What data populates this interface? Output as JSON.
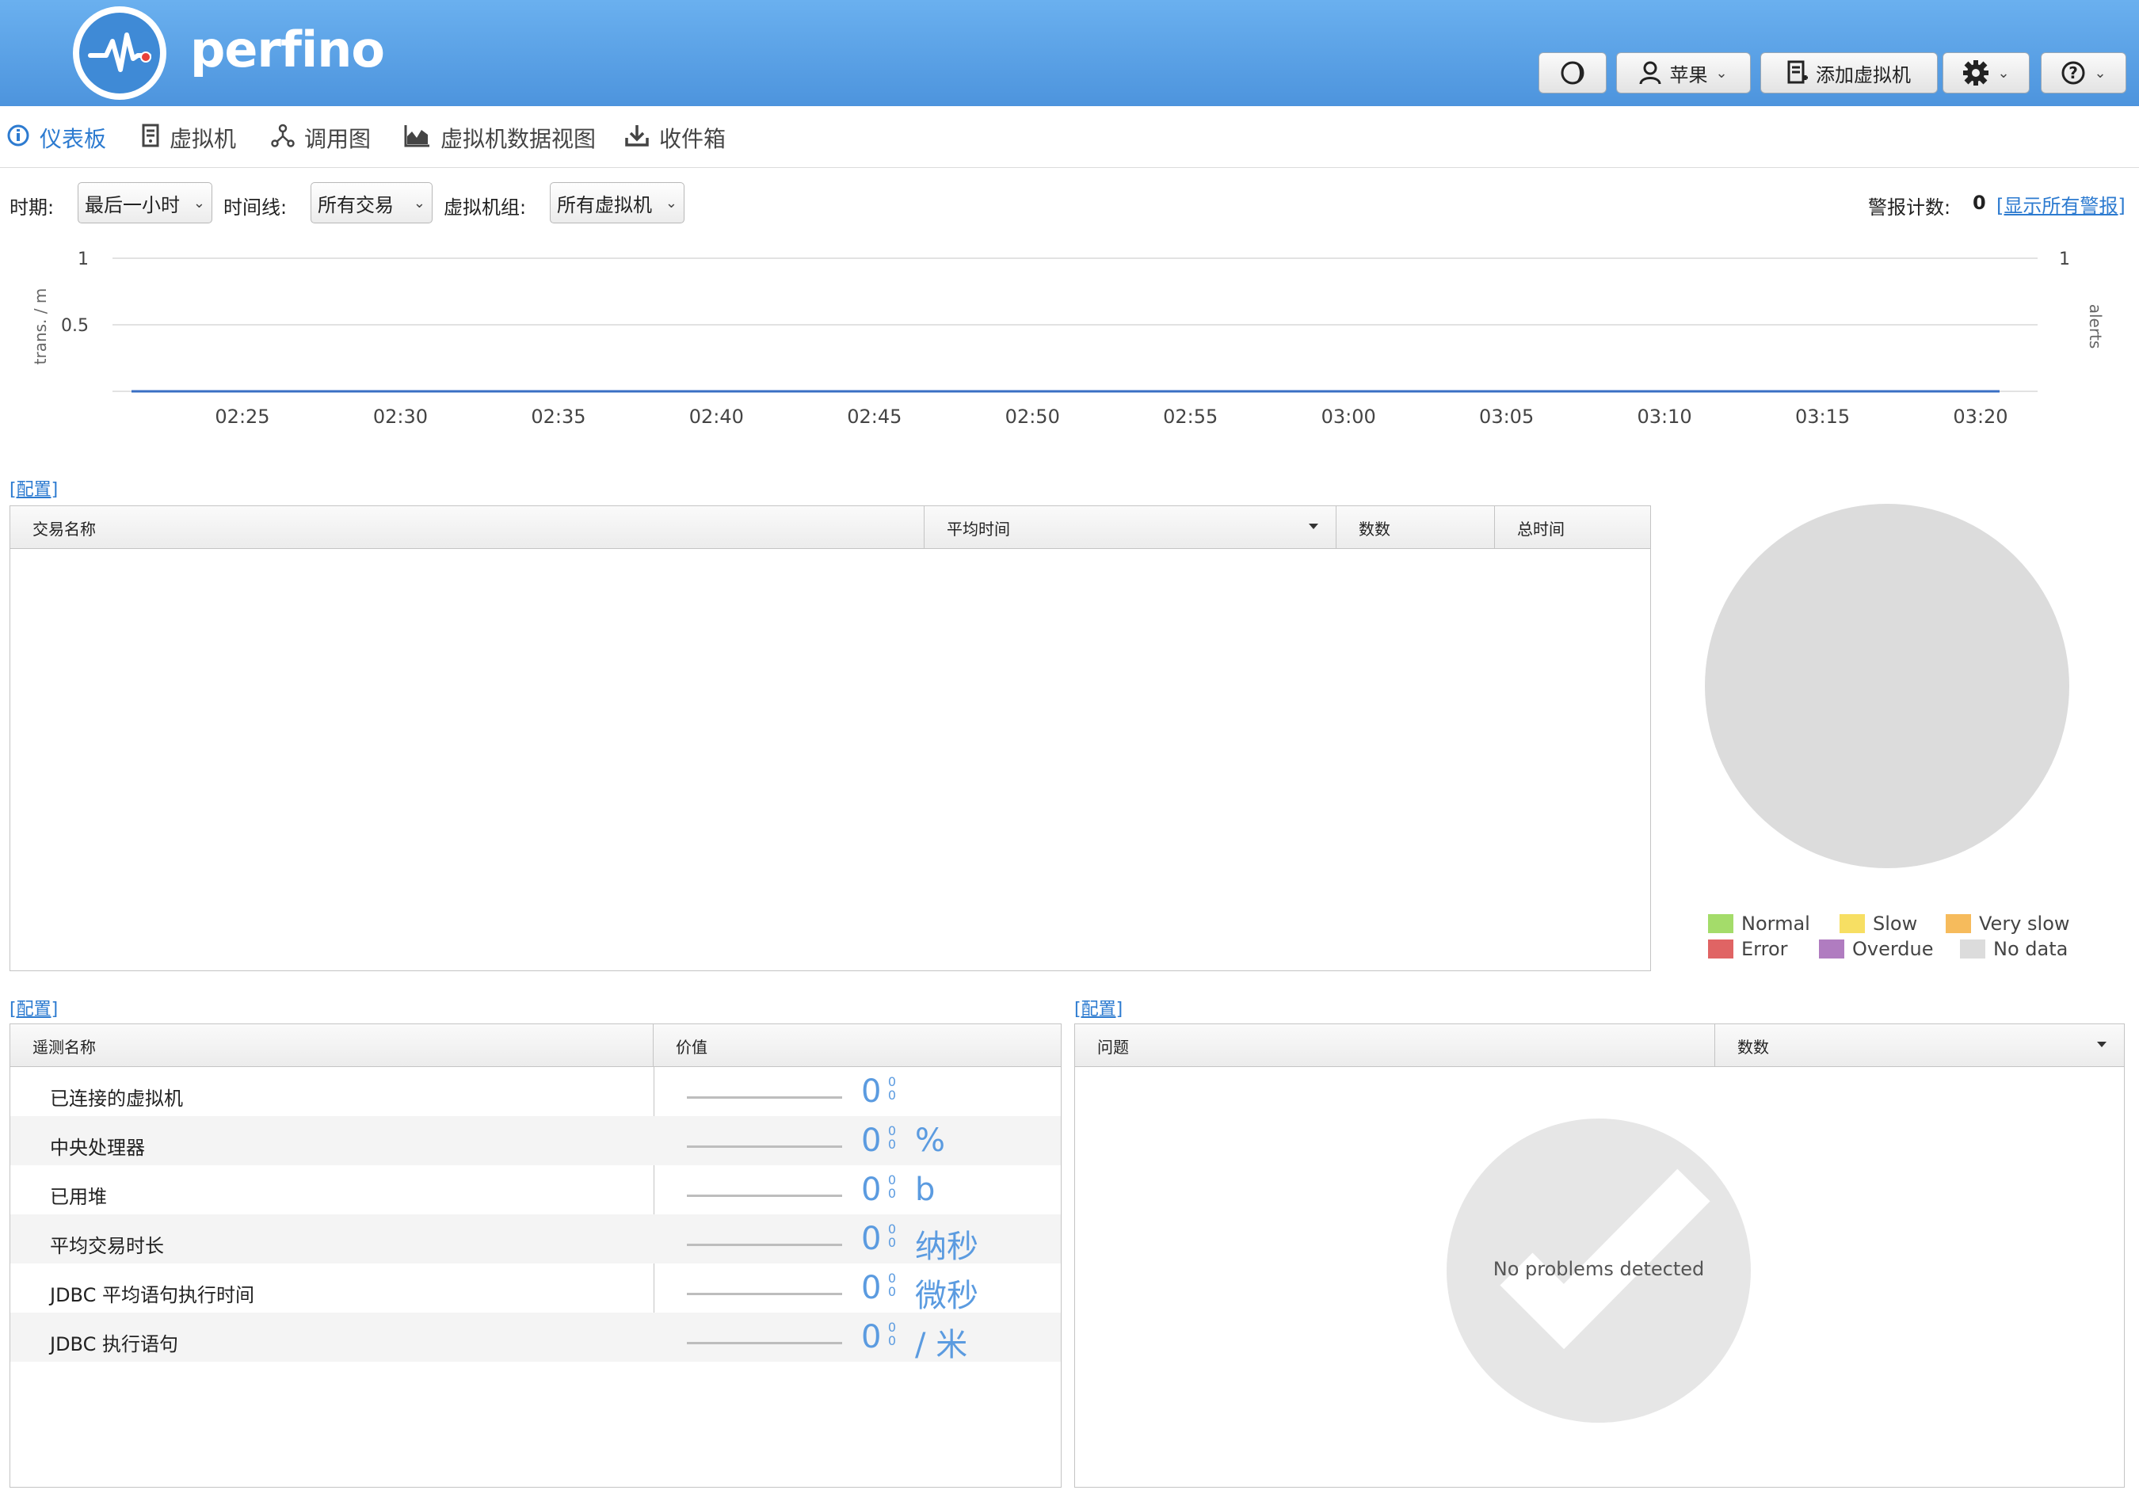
{
  "app": {
    "logo_text": "perfino"
  },
  "header": {
    "theme_icon": "moon-icon",
    "user_label": "苹果",
    "add_vm_label": "添加虚拟机",
    "settings_icon": "gear-icon",
    "help_icon": "help-icon"
  },
  "nav": {
    "tabs": [
      {
        "label": "仪表板",
        "icon": "info-icon",
        "active": true
      },
      {
        "label": "虚拟机",
        "icon": "server-icon",
        "active": false
      },
      {
        "label": "调用图",
        "icon": "graph-icon",
        "active": false
      },
      {
        "label": "虚拟机数据视图",
        "icon": "area-chart-icon",
        "active": false
      },
      {
        "label": "收件箱",
        "icon": "download-icon",
        "active": false
      }
    ]
  },
  "filters": {
    "period_label": "时期:",
    "period_value": "最后一小时",
    "timeline_label": "时间线:",
    "timeline_value": "所有交易",
    "vmgroup_label": "虚拟机组:",
    "vmgroup_value": "所有虚拟机",
    "alerts_label": "警报计数:",
    "alerts_count": "0",
    "alerts_link": "[显示所有警报]"
  },
  "chart_data": {
    "type": "line",
    "x": [
      "02:25",
      "02:30",
      "02:35",
      "02:40",
      "02:45",
      "02:50",
      "02:55",
      "03:00",
      "03:05",
      "03:10",
      "03:15",
      "03:20"
    ],
    "series": [
      {
        "values": [
          0,
          0,
          0,
          0,
          0,
          0,
          0,
          0,
          0,
          0,
          0,
          0
        ],
        "color": "#3a6fc4"
      }
    ],
    "ylabel": "trans. / m",
    "y2label": "alerts",
    "yticks": [
      "1",
      "0.5"
    ],
    "y2ticks": [
      "1"
    ],
    "ylim": [
      0,
      1
    ],
    "grid": true
  },
  "transactions": {
    "config_link": "[配置]",
    "columns": [
      "交易名称",
      "平均时间",
      "数数",
      "总时间"
    ],
    "rows": []
  },
  "pie_legend": [
    {
      "label": "Normal",
      "color": "#a4dc6a"
    },
    {
      "label": "Slow",
      "color": "#f7df63"
    },
    {
      "label": "Very slow",
      "color": "#f6bb5c"
    },
    {
      "label": "Error",
      "color": "#e06464"
    },
    {
      "label": "Overdue",
      "color": "#b07cc0"
    },
    {
      "label": "No data",
      "color": "#dcdcdc"
    }
  ],
  "telemetry": {
    "config_link": "[配置]",
    "columns": [
      "遥测名称",
      "价值"
    ],
    "rows": [
      {
        "name": "已连接的虚拟机",
        "value": "0",
        "small": "0\n0",
        "unit": ""
      },
      {
        "name": "中央处理器",
        "value": "0",
        "small": "0\n0",
        "unit": "%"
      },
      {
        "name": "已用堆",
        "value": "0",
        "small": "0\n0",
        "unit": "b"
      },
      {
        "name": "平均交易时长",
        "value": "0",
        "small": "0\n0",
        "unit": "纳秒"
      },
      {
        "name": "JDBC 平均语句执行时间",
        "value": "0",
        "small": "0\n0",
        "unit": "微秒"
      },
      {
        "name": "JDBC 执行语句",
        "value": "0",
        "small": "0\n0",
        "unit": "/ 米"
      }
    ]
  },
  "problems": {
    "config_link": "[配置]",
    "columns": [
      "问题",
      "数数"
    ],
    "empty_text": "No problems detected"
  }
}
